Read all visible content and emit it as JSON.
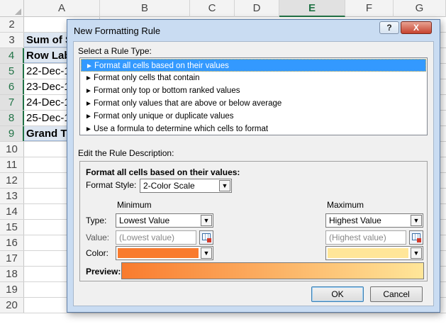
{
  "spreadsheet": {
    "columns": [
      "A",
      "B",
      "C",
      "D",
      "E",
      "F",
      "G"
    ],
    "active_column": "E",
    "rows": [
      {
        "num": "2",
        "a": ""
      },
      {
        "num": "3",
        "a": "Sum of S"
      },
      {
        "num": "4",
        "a": "Row Lab"
      },
      {
        "num": "5",
        "a": "22-Dec-1"
      },
      {
        "num": "6",
        "a": "23-Dec-1"
      },
      {
        "num": "7",
        "a": "24-Dec-1"
      },
      {
        "num": "8",
        "a": "25-Dec-1"
      },
      {
        "num": "9",
        "a": "Grand To"
      },
      {
        "num": "10",
        "a": ""
      },
      {
        "num": "11",
        "a": ""
      },
      {
        "num": "12",
        "a": ""
      },
      {
        "num": "13",
        "a": ""
      },
      {
        "num": "14",
        "a": ""
      },
      {
        "num": "15",
        "a": ""
      },
      {
        "num": "16",
        "a": ""
      },
      {
        "num": "17",
        "a": ""
      },
      {
        "num": "18",
        "a": ""
      },
      {
        "num": "19",
        "a": ""
      },
      {
        "num": "20",
        "a": ""
      }
    ]
  },
  "dialog": {
    "title": "New Formatting Rule",
    "help_label": "?",
    "close_label": "X",
    "select_rule_type_label": "Select a Rule Type:",
    "rule_types": [
      "Format all cells based on their values",
      "Format only cells that contain",
      "Format only top or bottom ranked values",
      "Format only values that are above or below average",
      "Format only unique or duplicate values",
      "Use a formula to determine which cells to format"
    ],
    "selected_rule_index": 0,
    "edit_description_label": "Edit the Rule Description:",
    "format_heading": "Format all cells based on their values:",
    "format_style_label": "Format Style:",
    "format_style_value": "2-Color Scale",
    "minimum": {
      "heading": "Minimum",
      "type_value": "Lowest Value",
      "value_placeholder": "(Lowest value)",
      "color": "#f97b2e"
    },
    "maximum": {
      "heading": "Maximum",
      "type_value": "Highest Value",
      "value_placeholder": "(Highest value)",
      "color": "#ffe699"
    },
    "type_label": "Type:",
    "value_label": "Value:",
    "color_label": "Color:",
    "preview_label": "Preview:",
    "ok_label": "OK",
    "cancel_label": "Cancel"
  }
}
